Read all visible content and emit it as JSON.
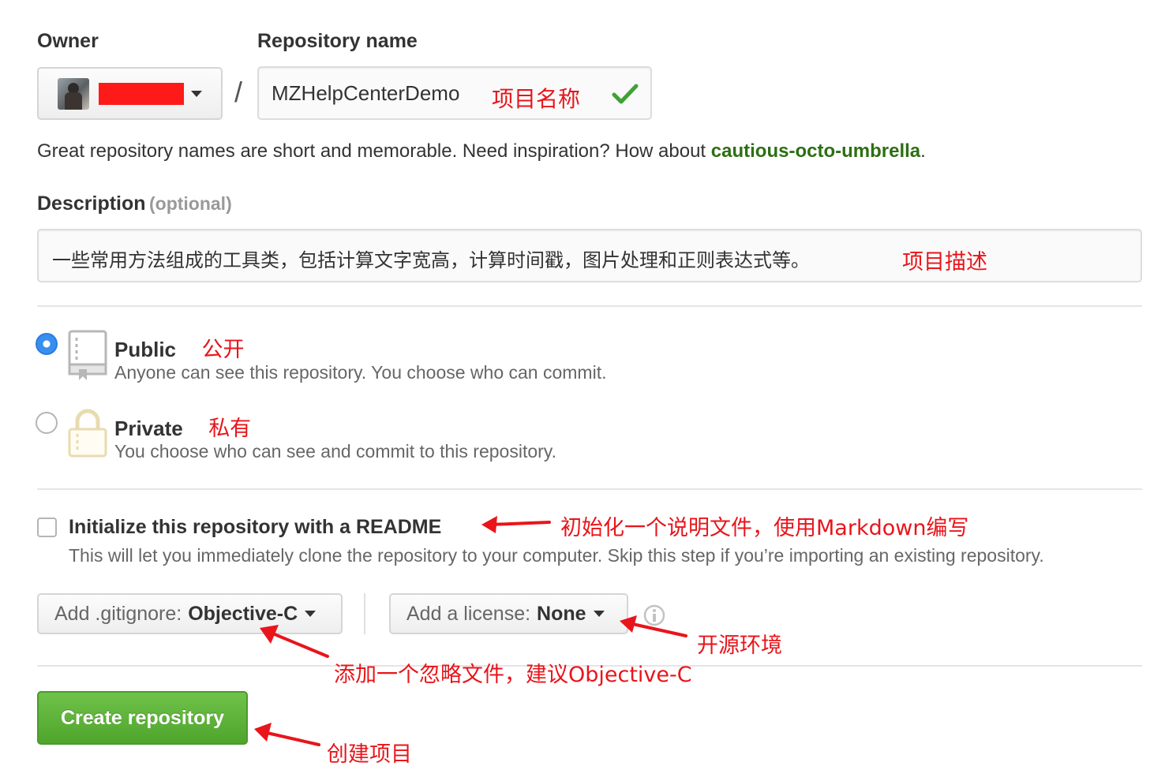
{
  "owner": {
    "label": "Owner",
    "avatar_icon": "user-avatar"
  },
  "repo": {
    "label": "Repository name",
    "separator": "/",
    "value": "MZHelpCenterDemo",
    "annotation": "项目名称",
    "valid_icon": "checkmark-icon"
  },
  "suggestion": {
    "prefix": "Great repository names are short and memorable. Need inspiration? How about ",
    "name": "cautious-octo-umbrella",
    "suffix": "."
  },
  "description": {
    "label": "Description",
    "optional": "(optional)",
    "value": "一些常用方法组成的工具类，包括计算文字宽高，计算时间戳，图片处理和正则表达式等。",
    "annotation": "项目描述"
  },
  "visibility": {
    "public": {
      "title": "Public",
      "annotation": "公开",
      "desc": "Anyone can see this repository. You choose who can commit.",
      "checked": true,
      "icon": "repo-book-icon"
    },
    "private": {
      "title": "Private",
      "annotation": "私有",
      "desc": "You choose who can see and commit to this repository.",
      "checked": false,
      "icon": "lock-icon"
    }
  },
  "readme": {
    "title": "Initialize this repository with a README",
    "desc": "This will let you immediately clone the repository to your computer. Skip this step if you’re importing an existing repository.",
    "annotation": "初始化一个说明文件，使用Markdown编写",
    "checked": false
  },
  "gitignore": {
    "prefix": "Add .gitignore:",
    "value": "Objective-C",
    "annotation": "添加一个忽略文件，建议Objective-C"
  },
  "license": {
    "prefix": "Add a license:",
    "value": "None",
    "annotation": "开源环境",
    "info_icon": "info-icon"
  },
  "create": {
    "label": "Create repository",
    "annotation": "创建项目"
  },
  "colors": {
    "annotation_red": "#e8151b",
    "suggestion_green": "#2d6f13",
    "create_green": "#55a532",
    "radio_blue": "#3a8ef0"
  }
}
